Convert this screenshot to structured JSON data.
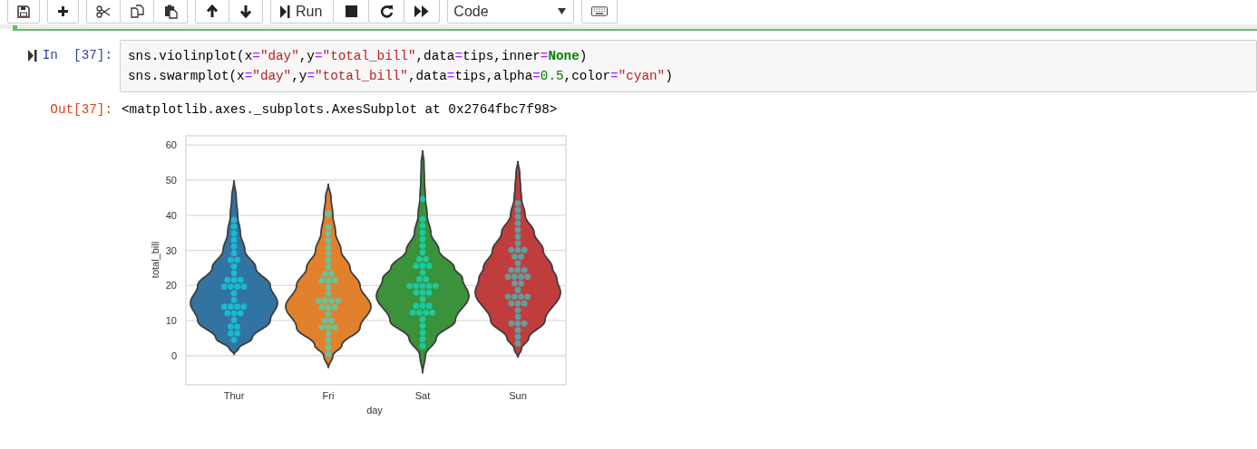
{
  "toolbar": {
    "run_label": "Run",
    "cell_type": "Code"
  },
  "cell": {
    "prompt_in": "In  [37]:",
    "code": [
      "sns.violinplot(x=\"day\",y=\"total_bill\",data=tips,inner=None)",
      "sns.swarmplot(x=\"day\",y=\"total_bill\",data=tips,alpha=0.5,color=\"cyan\")"
    ],
    "prompt_out": "Out[37]:",
    "output": "<matplotlib.axes._subplots.AxesSubplot at 0x2764fbc7f98>",
    "plot": {
      "xlabel": "day",
      "ylabel": "total_bill",
      "yticks": [
        "60",
        "50",
        "40",
        "30",
        "20",
        "10",
        "0"
      ],
      "categories": [
        {
          "name": "Thur",
          "color": "#3274a1"
        },
        {
          "name": "Fri",
          "color": "#e1812c"
        },
        {
          "name": "Sat",
          "color": "#3a923a"
        },
        {
          "name": "Sun",
          "color": "#c03d3e"
        }
      ]
    }
  }
}
